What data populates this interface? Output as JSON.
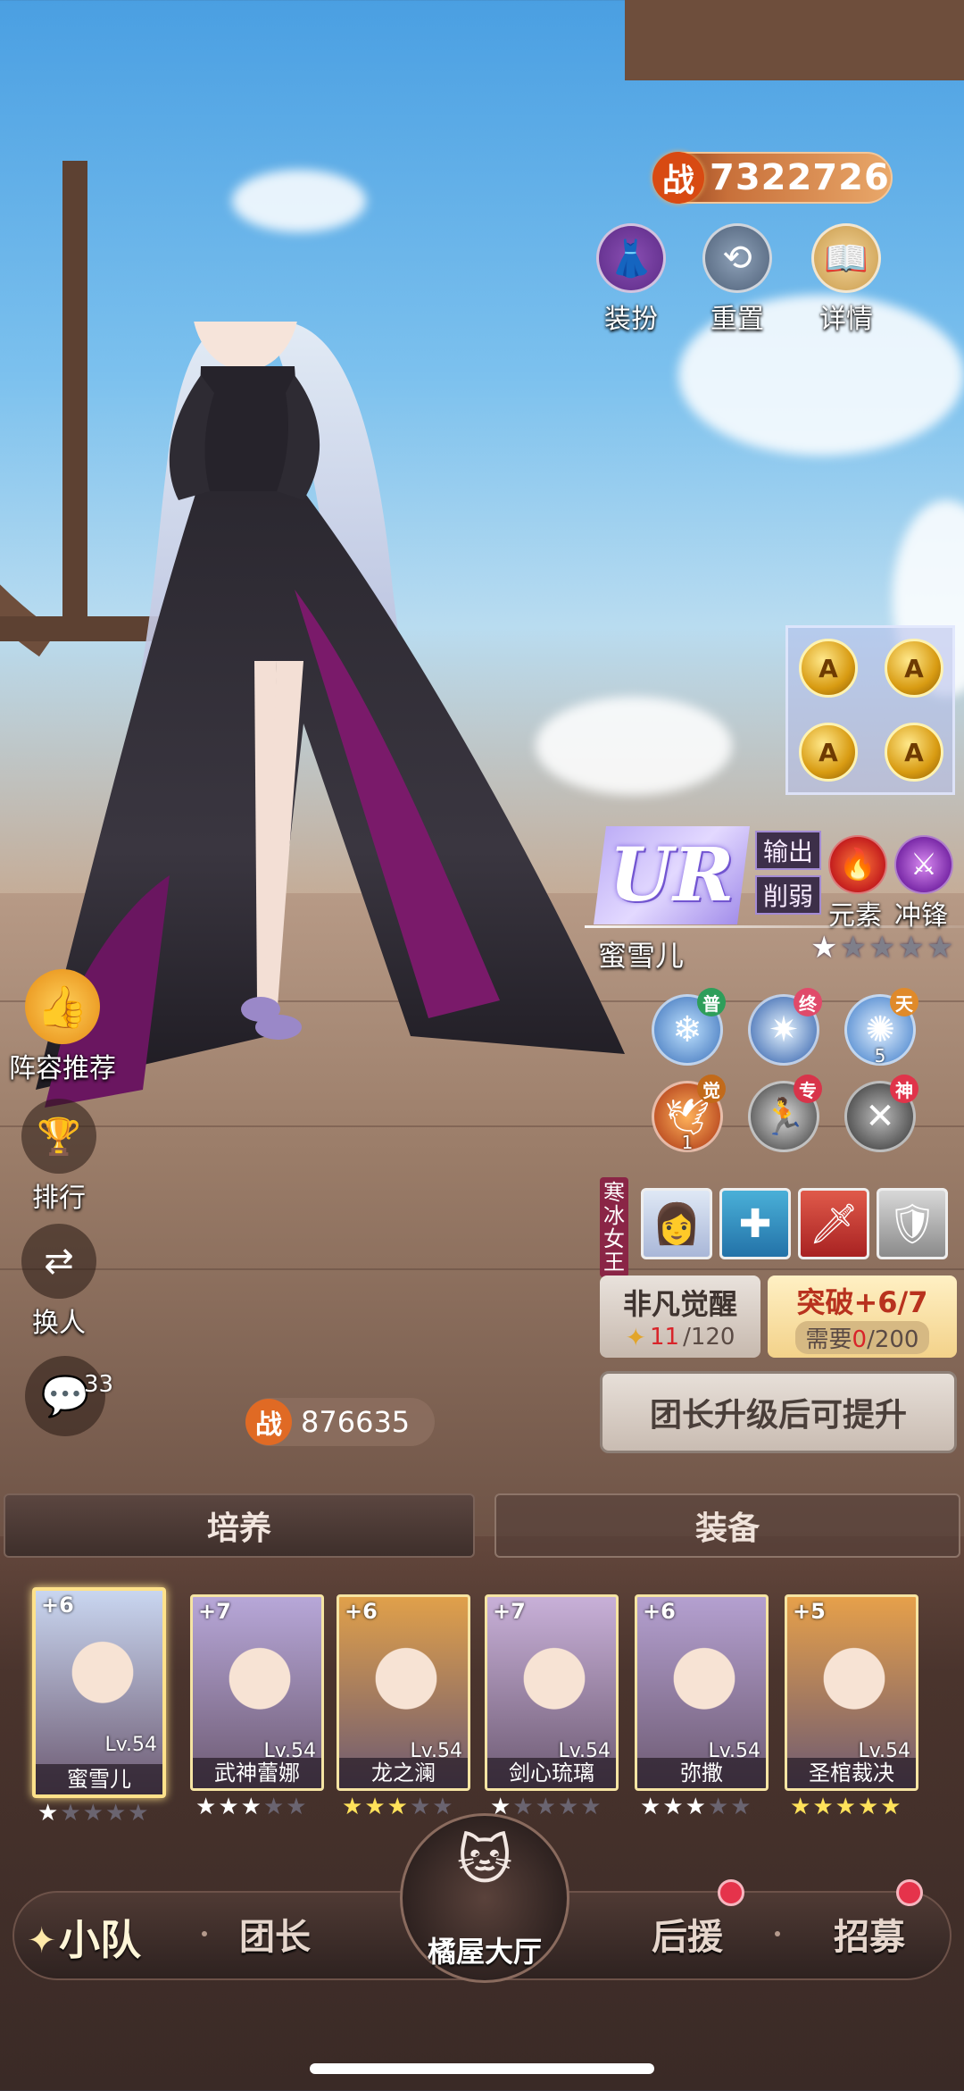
{
  "header": {
    "power_label": "战",
    "power_value": "7322726",
    "buttons": [
      {
        "label": "装扮",
        "icon": "outfit-icon"
      },
      {
        "label": "重置",
        "icon": "reset-icon"
      },
      {
        "label": "详情",
        "icon": "book-icon"
      }
    ]
  },
  "hero": {
    "rarity": "UR",
    "role_tags": [
      "输出",
      "削弱"
    ],
    "element_label": "元素",
    "class_label": "冲锋",
    "name": "蜜雪儿",
    "stars": 1,
    "max_stars": 5,
    "skills": [
      {
        "badge": "普",
        "badge_color": "#2e9e5a",
        "num": ""
      },
      {
        "badge": "终",
        "badge_color": "#e04a6a",
        "num": ""
      },
      {
        "badge": "天",
        "badge_color": "#e08a2a",
        "num": "5"
      },
      {
        "badge": "觉",
        "badge_color": "#c26a1a",
        "num": "1"
      },
      {
        "badge": "专",
        "badge_color": "#d8344a",
        "num": ""
      },
      {
        "badge": "神",
        "badge_color": "#e0344a",
        "num": ""
      }
    ],
    "awakening_title": "寒冰女王",
    "awakening": {
      "label": "非凡觉醒",
      "current": "11",
      "total": "/120"
    },
    "breakthrough": {
      "label": "突破+6/7",
      "need_label": "需要",
      "current": "0",
      "total": "/200"
    },
    "upgrade_button": "团长升级后可提升",
    "power_label": "战",
    "power_value": "876635"
  },
  "side_buttons": [
    {
      "label": "阵容推荐",
      "icon": "thumbs-up-icon"
    },
    {
      "label": "排行",
      "icon": "trophy-icon"
    },
    {
      "label": "换人",
      "icon": "swap-icon"
    }
  ],
  "chat": {
    "badge": "33"
  },
  "tabs": [
    "培养",
    "装备"
  ],
  "roster": [
    {
      "name": "蜜雪儿",
      "plus": "+6",
      "level": "Lv.54",
      "stars": 1,
      "bg": "#c9d6f0"
    },
    {
      "name": "武神蕾娜",
      "plus": "+7",
      "level": "Lv.54",
      "stars": 3,
      "bg": "#b7a7d8"
    },
    {
      "name": "龙之澜",
      "plus": "+6",
      "level": "Lv.54",
      "stars": 3,
      "bg": "#e0a04a"
    },
    {
      "name": "剑心琉璃",
      "plus": "+7",
      "level": "Lv.54",
      "stars": 1,
      "bg": "#c8b0d8"
    },
    {
      "name": "弥撒",
      "plus": "+6",
      "level": "Lv.54",
      "stars": 3,
      "bg": "#b4a0d0"
    },
    {
      "name": "圣棺裁决",
      "plus": "+5",
      "level": "Lv.54",
      "stars": 5,
      "bg": "#e6a04a"
    }
  ],
  "nav": {
    "items": [
      "小队",
      "团长",
      "后援",
      "招募"
    ],
    "home_label": "橘屋大厅"
  }
}
